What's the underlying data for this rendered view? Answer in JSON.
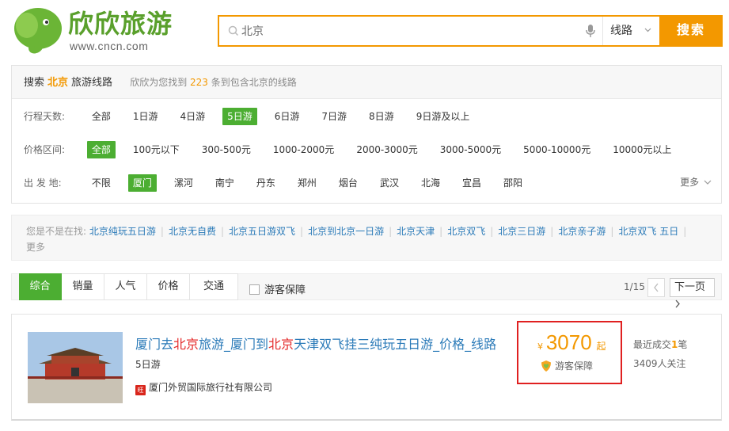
{
  "header": {
    "logo_text": "欣欣旅游",
    "logo_url": "www.cncn.com",
    "search_value": "北京",
    "search_type": "线路",
    "search_button": "搜索"
  },
  "filter": {
    "head_prefix": "搜索",
    "head_keyword": "北京",
    "head_suffix": "旅游线路",
    "result_prefix": "欣欣为您找到",
    "result_count": "223",
    "result_suffix": "条到包含北京的线路",
    "days_label": "行程天数:",
    "days_options": [
      "全部",
      "1日游",
      "4日游",
      "5日游",
      "6日游",
      "7日游",
      "8日游",
      "9日游及以上"
    ],
    "price_label": "价格区间:",
    "price_options": [
      "全部",
      "100元以下",
      "300-500元",
      "1000-2000元",
      "2000-3000元",
      "3000-5000元",
      "5000-10000元",
      "10000元以上"
    ],
    "origin_label": "出 发 地:",
    "origin_options": [
      "不限",
      "厦门",
      "漯河",
      "南宁",
      "丹东",
      "郑州",
      "烟台",
      "武汉",
      "北海",
      "宜昌",
      "邵阳"
    ],
    "more_label": "更多"
  },
  "suggest": {
    "label": "您是不是在找:",
    "links": [
      "北京纯玩五日游",
      "北京无自费",
      "北京五日游双飞",
      "北京到北京一日游",
      "北京天津",
      "北京双飞",
      "北京三日游",
      "北京亲子游",
      "北京双飞 五日"
    ],
    "more": "更多"
  },
  "sortbar": {
    "tabs": [
      "综合",
      "销量",
      "人气",
      "价格",
      "交通"
    ],
    "guarantee": "游客保障",
    "page": "1/15",
    "next": "下一页"
  },
  "result": {
    "title_parts": [
      "厦门去",
      "北京",
      "旅游_厦门到",
      "北京",
      "天津双飞挂三纯玩五日游_价格_线路"
    ],
    "days": "5日游",
    "agency_badge": "旺",
    "agency": "厦门外贸国际旅行社有限公司",
    "currency": "¥",
    "price": "3070",
    "price_suffix": "起",
    "guarantee": "游客保障",
    "recent_prefix": "最近成交",
    "recent_count": "1",
    "recent_suffix": "笔",
    "followers": "3409人关注"
  },
  "colors": {
    "accent": "#f39800",
    "green": "#4cae32",
    "link": "#2a7ab8",
    "highlight": "#e42b2b",
    "price_box": "#e02020"
  }
}
